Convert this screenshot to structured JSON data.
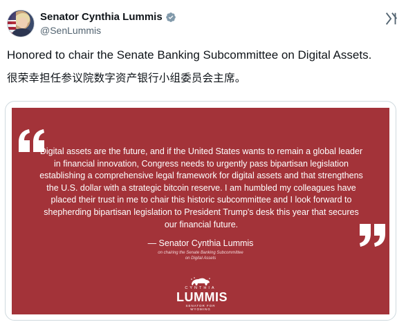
{
  "author": {
    "name": "Senator Cynthia Lummis",
    "handle": "@SenLummis"
  },
  "post": {
    "text_en": "Honored to chair the Senate Banking Subcommittee on Digital Assets.",
    "text_cn": "很荣幸担任参议院数字资产银行小组委员会主席。"
  },
  "card": {
    "quote": "Digital assets are the future, and if the United States wants to remain a global leader in financial innovation, Congress needs to urgently pass bipartisan legislation establishing a comprehensive legal framework for digital assets and that strengthens the U.S. dollar with a strategic bitcoin reserve. I am humbled my colleagues have placed their trust in me to chair this historic subcommittee and I look forward to shepherding bipartisan legislation to President Trump's desk this year that secures our financial future.",
    "attribution": "— Senator Cynthia Lummis",
    "attribution_sub": "on chairing the Senate Banking Subcommittee on Digital Assets",
    "logo_top": "CYNTHIA",
    "logo_main": "LUMMIS",
    "logo_bottom": "SENATOR FOR WYOMING",
    "background_color": "#a33339"
  },
  "icons": {
    "verified": "verified-badge-icon",
    "grok": "grok-icon",
    "more": "more-icon"
  }
}
